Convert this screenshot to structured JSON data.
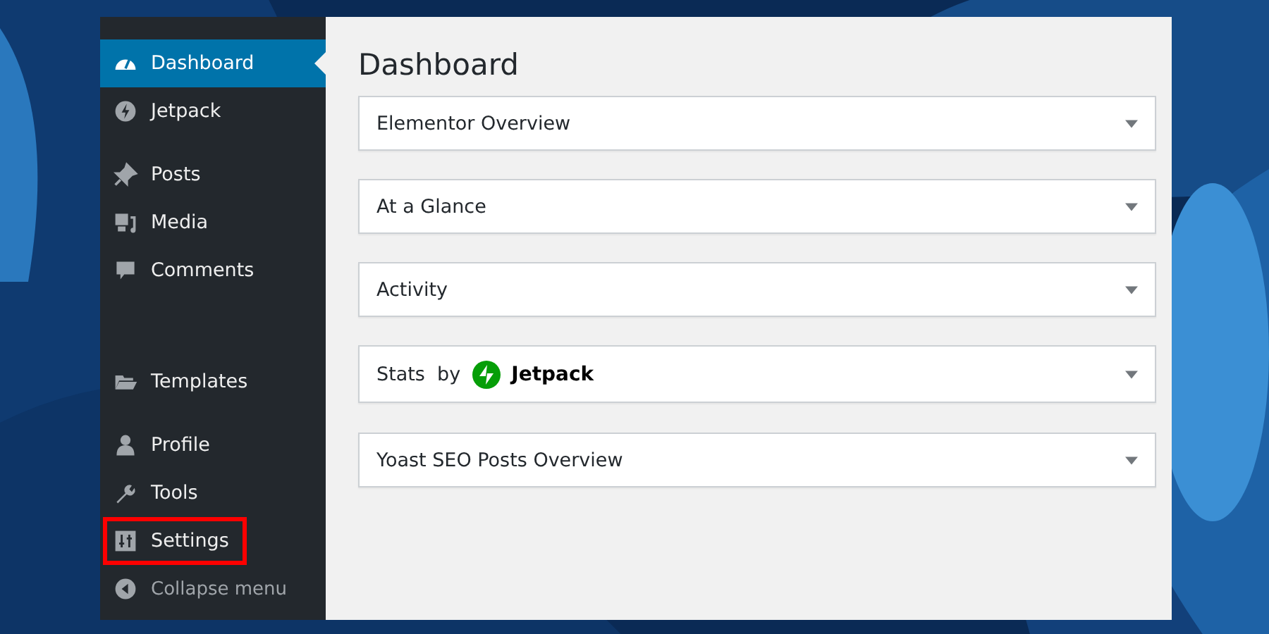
{
  "sidebar": {
    "groups": [
      [
        {
          "label": "Dashboard",
          "kind": "gauge",
          "selected": true,
          "highlighted": false
        },
        {
          "label": "Jetpack",
          "kind": "bolt",
          "selected": false,
          "highlighted": false
        }
      ],
      [
        {
          "label": "Posts",
          "kind": "pin",
          "selected": false,
          "highlighted": false
        },
        {
          "label": "Media",
          "kind": "media",
          "selected": false,
          "highlighted": false
        },
        {
          "label": "Comments",
          "kind": "bubble",
          "selected": false,
          "highlighted": false
        }
      ],
      [
        {
          "label": "Templates",
          "kind": "folder",
          "selected": false,
          "highlighted": false
        }
      ],
      [
        {
          "label": "Profile",
          "kind": "person",
          "selected": false,
          "highlighted": false
        },
        {
          "label": "Tools",
          "kind": "wrench",
          "selected": false,
          "highlighted": false
        },
        {
          "label": "Settings",
          "kind": "sliders",
          "selected": false,
          "highlighted": true
        }
      ]
    ],
    "collapse": "Collapse menu"
  },
  "main": {
    "title": "Dashboard",
    "panels": [
      {
        "kind": "plain",
        "title": "Elementor Overview"
      },
      {
        "kind": "plain",
        "title": "At a Glance"
      },
      {
        "kind": "plain",
        "title": "Activity"
      },
      {
        "kind": "brand",
        "title": "Stats  by",
        "brand": "Jetpack"
      },
      {
        "kind": "plain",
        "title": "Yoast SEO Posts Overview"
      }
    ]
  }
}
